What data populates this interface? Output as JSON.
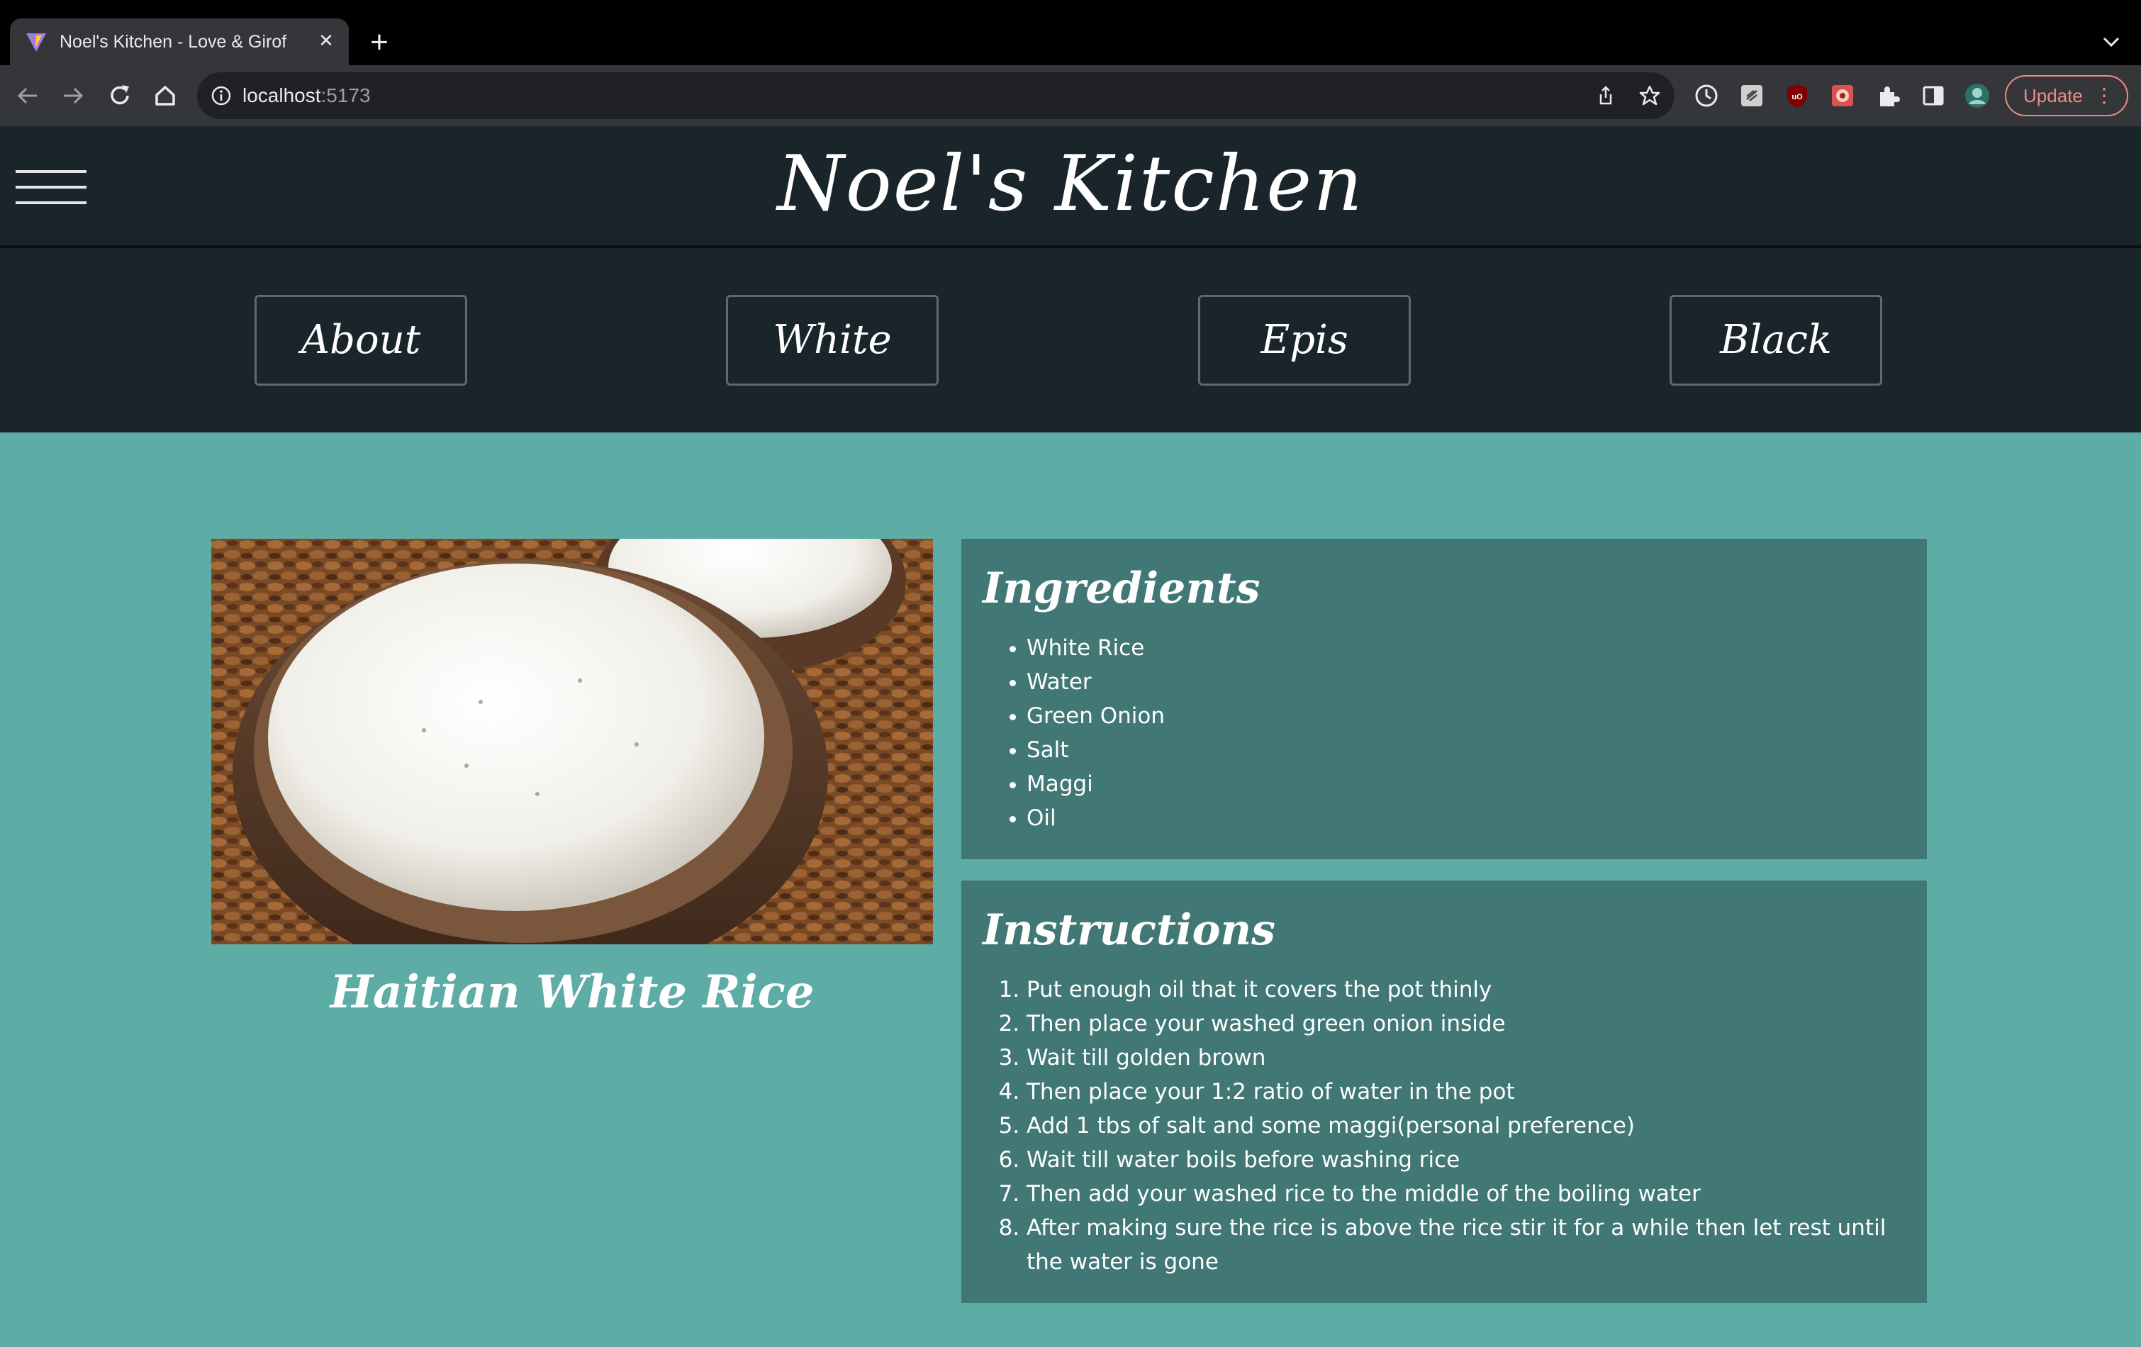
{
  "browser": {
    "tab_title": "Noel's Kitchen - Love & Girof",
    "url_host": "localhost",
    "url_port": ":5173",
    "update_label": "Update"
  },
  "site": {
    "title": "Noel's Kitchen",
    "nav": [
      "About",
      "White",
      "Epis",
      "Black"
    ]
  },
  "recipe": {
    "name": "Haitian White Rice",
    "ingredients_heading": "Ingredients",
    "ingredients": [
      "White Rice",
      "Water",
      "Green Onion",
      "Salt",
      "Maggi",
      "Oil"
    ],
    "instructions_heading": "Instructions",
    "instructions": [
      "Put enough oil that it covers the pot thinly",
      "Then place your washed green onion inside",
      "Wait till golden brown",
      "Then place your 1:2 ratio of water in the pot",
      "Add 1 tbs of salt and some maggi(personal preference)",
      "Wait till water boils before washing rice",
      "Then add your washed rice to the middle of the boiling water",
      "After making sure the rice is above the rice stir it for a while then let rest until the water is gone"
    ]
  },
  "colors": {
    "page_bg": "#5eaca6",
    "header_bg": "#1a252b",
    "panel_bg": "#417875"
  }
}
